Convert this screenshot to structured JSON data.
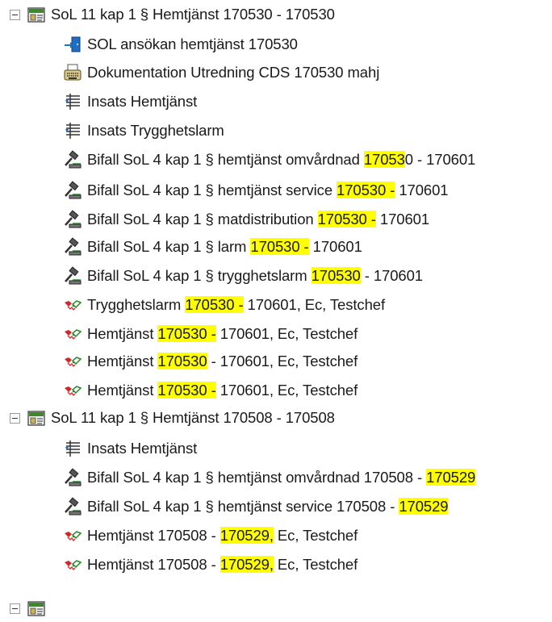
{
  "tree": {
    "nodes": [
      {
        "type": "case",
        "icon": "case-folder-icon",
        "expanded": true,
        "segments": [
          {
            "text": "SoL 11 kap 1 § Hemtjänst 170530 - 170530"
          }
        ]
      },
      {
        "type": "application",
        "icon": "application-door-icon",
        "segments": [
          {
            "text": "SOL ansökan hemtjänst 170530"
          }
        ]
      },
      {
        "type": "documentation",
        "icon": "documentation-typewriter-icon",
        "segments": [
          {
            "text": "Dokumentation Utredning CDS 170530 mahj"
          }
        ]
      },
      {
        "type": "insats",
        "icon": "insats-list-icon",
        "segments": [
          {
            "text": "Insats Hemtjänst"
          }
        ]
      },
      {
        "type": "insats",
        "icon": "insats-list-icon",
        "segments": [
          {
            "text": "Insats Trygghetslarm"
          }
        ]
      },
      {
        "type": "decision",
        "icon": "decision-gavel-icon",
        "segments": [
          {
            "text": "Bifall SoL 4 kap 1 § hemtjänst omvårdnad "
          },
          {
            "text": "17053",
            "hl": true
          },
          {
            "text": "0 - 170601"
          }
        ]
      },
      {
        "type": "decision",
        "icon": "decision-gavel-icon",
        "segments": [
          {
            "text": "Bifall SoL 4 kap 1 § hemtjänst service "
          },
          {
            "text": "170530 -",
            "hl": true
          },
          {
            "text": " 170601"
          }
        ]
      },
      {
        "type": "decision",
        "icon": "decision-gavel-icon",
        "segments": [
          {
            "text": "Bifall SoL 4 kap 1 § matdistribution "
          },
          {
            "text": "170530 -",
            "hl": true
          },
          {
            "text": " 170601"
          }
        ]
      },
      {
        "type": "decision",
        "icon": "decision-gavel-icon",
        "segments": [
          {
            "text": "Bifall SoL 4 kap 1 § larm "
          },
          {
            "text": "170530 -",
            "hl": true
          },
          {
            "text": " 170601"
          }
        ]
      },
      {
        "type": "decision",
        "icon": "decision-gavel-icon",
        "segments": [
          {
            "text": "Bifall SoL 4 kap 1 § trygghetslarm "
          },
          {
            "text": "170530",
            "hl": true
          },
          {
            "text": " - 170601"
          }
        ]
      },
      {
        "type": "execution",
        "icon": "execution-handshake-icon",
        "segments": [
          {
            "text": "Trygghetslarm "
          },
          {
            "text": "170530 -",
            "hl": true
          },
          {
            "text": " 170601, Ec, Testchef"
          }
        ]
      },
      {
        "type": "execution",
        "icon": "execution-handshake-icon",
        "segments": [
          {
            "text": "Hemtjänst "
          },
          {
            "text": "170530 -",
            "hl": true
          },
          {
            "text": " 170601, Ec, Testchef"
          }
        ]
      },
      {
        "type": "execution",
        "icon": "execution-handshake-icon",
        "segments": [
          {
            "text": "Hemtjänst "
          },
          {
            "text": "170530",
            "hl": true
          },
          {
            "text": " - 170601, Ec, Testchef"
          }
        ]
      },
      {
        "type": "execution",
        "icon": "execution-handshake-icon",
        "segments": [
          {
            "text": "Hemtjänst "
          },
          {
            "text": "170530 -",
            "hl": true
          },
          {
            "text": " 170601, Ec, Testchef"
          }
        ]
      },
      {
        "type": "case",
        "icon": "case-folder-icon",
        "expanded": true,
        "segments": [
          {
            "text": "SoL 11 kap 1 § Hemtjänst 170508 - 170508"
          }
        ]
      },
      {
        "type": "insats",
        "icon": "insats-list-icon",
        "segments": [
          {
            "text": "Insats Hemtjänst"
          }
        ]
      },
      {
        "type": "decision",
        "icon": "decision-gavel-icon",
        "segments": [
          {
            "text": "Bifall SoL 4 kap 1 § hemtjänst omvårdnad 170508 - "
          },
          {
            "text": "170529",
            "hl": true
          }
        ]
      },
      {
        "type": "decision",
        "icon": "decision-gavel-icon",
        "segments": [
          {
            "text": "Bifall SoL 4 kap 1 § hemtjänst service 170508 - "
          },
          {
            "text": "170529",
            "hl": true
          }
        ]
      },
      {
        "type": "execution",
        "icon": "execution-handshake-icon",
        "segments": [
          {
            "text": "Hemtjänst 170508 - "
          },
          {
            "text": "170529,",
            "hl": true
          },
          {
            "text": " Ec, Testchef"
          }
        ]
      },
      {
        "type": "execution",
        "icon": "execution-handshake-icon",
        "segments": [
          {
            "text": "Hemtjänst 170508 - "
          },
          {
            "text": "170529,",
            "hl": true
          },
          {
            "text": " Ec, Testchef"
          }
        ]
      },
      {
        "type": "case",
        "icon": "case-folder-icon",
        "expanded": false,
        "partial": true,
        "segments": []
      }
    ]
  },
  "colors": {
    "highlight": "#ffff00",
    "text": "#1a1a1a"
  }
}
